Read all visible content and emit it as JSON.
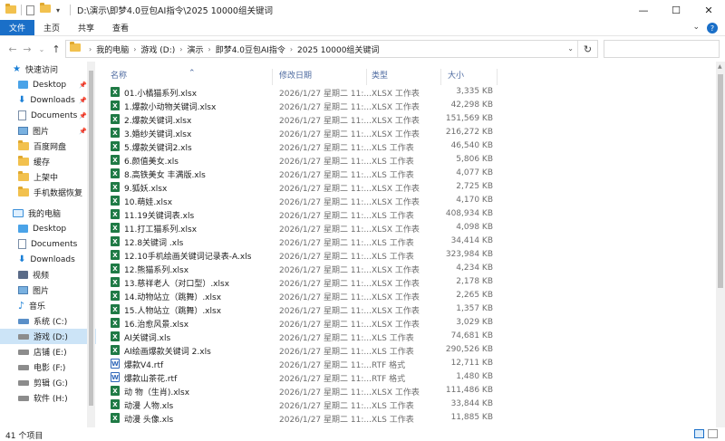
{
  "window": {
    "title": "D:\\演示\\即梦4.0豆包AI指令\\2025 10000组关键词",
    "controls": {
      "minimize": "—",
      "maximize": "☐",
      "close": "✕"
    }
  },
  "ribbon": {
    "tabs": [
      "文件",
      "主页",
      "共享",
      "查看"
    ],
    "expand_glyph": "⌄",
    "help_glyph": "?"
  },
  "nav_buttons": {
    "back": "←",
    "forward": "→",
    "recent": "⌄",
    "up": "↑"
  },
  "address": {
    "crumbs": [
      "我的电脑",
      "游戏 (D:)",
      "演示",
      "即梦4.0豆包AI指令",
      "2025 10000组关键词"
    ],
    "separator": "›",
    "dropdown_glyph": "⌄",
    "refresh_glyph": "↻"
  },
  "search": {
    "placeholder": ""
  },
  "nav_pane": {
    "quick_access_label": "快速访问",
    "quick_items": [
      {
        "label": "Desktop",
        "icon": "desktop-icon",
        "pinned": true
      },
      {
        "label": "Downloads",
        "icon": "downloads-icon",
        "pinned": true
      },
      {
        "label": "Documents",
        "icon": "documents-icon",
        "pinned": true
      },
      {
        "label": "图片",
        "icon": "pictures-icon",
        "pinned": true
      },
      {
        "label": "百度网盘",
        "icon": "folder-icon",
        "pinned": false
      },
      {
        "label": "缓存",
        "icon": "folder-icon",
        "pinned": false
      },
      {
        "label": "上架中",
        "icon": "folder-icon",
        "pinned": false
      },
      {
        "label": "手机数据恢复",
        "icon": "folder-icon",
        "pinned": false
      }
    ],
    "pc_label": "我的电脑",
    "pc_items": [
      {
        "label": "Desktop",
        "icon": "desktop-icon",
        "selected": false
      },
      {
        "label": "Documents",
        "icon": "documents-icon",
        "selected": false
      },
      {
        "label": "Downloads",
        "icon": "downloads-icon",
        "selected": false
      },
      {
        "label": "视频",
        "icon": "videos-icon",
        "selected": false
      },
      {
        "label": "图片",
        "icon": "pictures-icon",
        "selected": false
      },
      {
        "label": "音乐",
        "icon": "music-icon",
        "selected": false
      },
      {
        "label": "系统 (C:)",
        "icon": "system-drive-icon",
        "selected": false
      },
      {
        "label": "游戏 (D:)",
        "icon": "drive-icon",
        "selected": true
      },
      {
        "label": "店铺 (E:)",
        "icon": "drive-icon",
        "selected": false
      },
      {
        "label": "电影 (F:)",
        "icon": "drive-icon",
        "selected": false
      },
      {
        "label": "剪辑 (G:)",
        "icon": "drive-icon",
        "selected": false
      },
      {
        "label": "软件 (H:)",
        "icon": "drive-icon",
        "selected": false
      }
    ],
    "pin_glyph": "📌"
  },
  "columns": {
    "name": "名称",
    "modified": "修改日期",
    "type": "类型",
    "size": "大小"
  },
  "files": [
    {
      "name": "01.小橘猫系列.xlsx",
      "date": "2026/1/27 星期二 11:...",
      "type": "XLSX 工作表",
      "size": "3,335 KB",
      "kind": "x"
    },
    {
      "name": "1.爆款小动物关键词.xlsx",
      "date": "2026/1/27 星期二 11:...",
      "type": "XLSX 工作表",
      "size": "42,298 KB",
      "kind": "x"
    },
    {
      "name": "2.爆款关键词.xlsx",
      "date": "2026/1/27 星期二 11:...",
      "type": "XLSX 工作表",
      "size": "151,569 KB",
      "kind": "x"
    },
    {
      "name": "3.婚纱关键词.xlsx",
      "date": "2026/1/27 星期二 11:...",
      "type": "XLSX 工作表",
      "size": "216,272 KB",
      "kind": "x"
    },
    {
      "name": "5.爆款关键词2.xls",
      "date": "2026/1/27 星期二 11:...",
      "type": "XLS 工作表",
      "size": "46,540 KB",
      "kind": "x"
    },
    {
      "name": "6.颜值美女.xls",
      "date": "2026/1/27 星期二 11:...",
      "type": "XLS 工作表",
      "size": "5,806 KB",
      "kind": "x"
    },
    {
      "name": "8.高铁美女 丰满版.xls",
      "date": "2026/1/27 星期二 11:...",
      "type": "XLS 工作表",
      "size": "4,077 KB",
      "kind": "x"
    },
    {
      "name": "9.狐妖.xlsx",
      "date": "2026/1/27 星期二 11:...",
      "type": "XLSX 工作表",
      "size": "2,725 KB",
      "kind": "x"
    },
    {
      "name": "10.萌娃.xlsx",
      "date": "2026/1/27 星期二 11:...",
      "type": "XLSX 工作表",
      "size": "4,170 KB",
      "kind": "x"
    },
    {
      "name": "11.19关键词表.xls",
      "date": "2026/1/27 星期二 11:...",
      "type": "XLS 工作表",
      "size": "408,934 KB",
      "kind": "x"
    },
    {
      "name": "11.打工猫系列.xlsx",
      "date": "2026/1/27 星期二 11:...",
      "type": "XLSX 工作表",
      "size": "4,098 KB",
      "kind": "x"
    },
    {
      "name": "12.8关键词 .xls",
      "date": "2026/1/27 星期二 11:...",
      "type": "XLS 工作表",
      "size": "34,414 KB",
      "kind": "x"
    },
    {
      "name": "12.10手机绘画关键词记录表-A.xls",
      "date": "2026/1/27 星期二 11:...",
      "type": "XLS 工作表",
      "size": "323,984 KB",
      "kind": "x"
    },
    {
      "name": "12.熊猫系列.xlsx",
      "date": "2026/1/27 星期二 11:...",
      "type": "XLSX 工作表",
      "size": "4,234 KB",
      "kind": "x"
    },
    {
      "name": "13.慈祥老人（对口型）.xlsx",
      "date": "2026/1/27 星期二 11:...",
      "type": "XLSX 工作表",
      "size": "2,178 KB",
      "kind": "x"
    },
    {
      "name": "14.动物站立（跳舞）.xlsx",
      "date": "2026/1/27 星期二 11:...",
      "type": "XLSX 工作表",
      "size": "2,265 KB",
      "kind": "x"
    },
    {
      "name": "15.人物站立（跳舞）.xlsx",
      "date": "2026/1/27 星期二 11:...",
      "type": "XLSX 工作表",
      "size": "1,357 KB",
      "kind": "x"
    },
    {
      "name": "16.治愈风景.xlsx",
      "date": "2026/1/27 星期二 11:...",
      "type": "XLSX 工作表",
      "size": "3,029 KB",
      "kind": "x"
    },
    {
      "name": "AI关键词.xls",
      "date": "2026/1/27 星期二 11:...",
      "type": "XLS 工作表",
      "size": "74,681 KB",
      "kind": "x"
    },
    {
      "name": "AI绘画爆款关键词 2.xls",
      "date": "2026/1/27 星期二 11:...",
      "type": "XLS 工作表",
      "size": "290,526 KB",
      "kind": "x"
    },
    {
      "name": "爆款V4.rtf",
      "date": "2026/1/27 星期二 11:...",
      "type": "RTF 格式",
      "size": "12,711 KB",
      "kind": "r"
    },
    {
      "name": "爆款山茶花.rtf",
      "date": "2026/1/27 星期二 11:...",
      "type": "RTF 格式",
      "size": "1,480 KB",
      "kind": "r"
    },
    {
      "name": "动 物（生肖).xlsx",
      "date": "2026/1/27 星期二 11:...",
      "type": "XLSX 工作表",
      "size": "111,486 KB",
      "kind": "x"
    },
    {
      "name": "动漫 人物.xls",
      "date": "2026/1/27 星期二 11:...",
      "type": "XLS 工作表",
      "size": "33,844 KB",
      "kind": "x"
    },
    {
      "name": "动漫 头像.xls",
      "date": "2026/1/27 星期二 11:...",
      "type": "XLS 工作表",
      "size": "11,885 KB",
      "kind": "x"
    }
  ],
  "status": {
    "count_text": "41 个项目"
  }
}
